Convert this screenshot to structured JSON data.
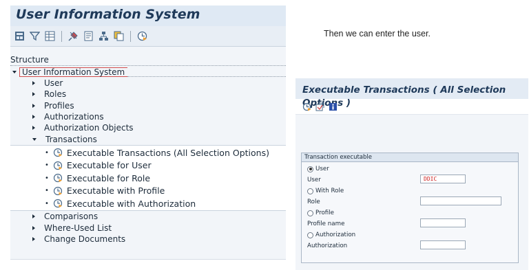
{
  "left_panel": {
    "title": "User Information System",
    "toolbar_icons": [
      "grid-save-icon",
      "filter-icon",
      "table-icon",
      "pin-icon",
      "document-icon",
      "hierarchy-icon",
      "copy-icon",
      "clock-execute-icon"
    ],
    "structure_label": "Structure",
    "root_label": "User Information System",
    "tree_items_top": [
      "User",
      "Roles",
      "Profiles",
      "Authorizations",
      "Authorization Objects"
    ],
    "transactions_label": "Transactions",
    "transaction_items": [
      "Executable Transactions (All Selection Options)",
      "Executable for User",
      "Executable for Role",
      "Executable with Profile",
      "Executable with Authorization"
    ],
    "tree_items_bottom": [
      "Comparisons",
      "Where-Used List",
      "Change Documents"
    ]
  },
  "caption": "Then we can enter the user.",
  "right_panel": {
    "title": "Executable Transactions ( All Selection Options )",
    "toolbar_icons": [
      "clock-execute-icon",
      "variant-icon",
      "info-icon"
    ],
    "group_title": "Transaction executable",
    "radio_user": "User",
    "label_user": "User",
    "user_value": "DDIC",
    "radio_role": "With Role",
    "label_role": "Role",
    "role_value": "",
    "radio_profile": "Profile",
    "label_profile": "Profile name",
    "profile_value": "",
    "radio_authorization": "Authorization",
    "label_authorization": "Authorization",
    "authorization_value": "",
    "selected_radio": "User"
  },
  "colors": {
    "title_text": "#1f3a5a",
    "panel_bg": "#f2f5f9",
    "selected_outline": "#d24b4b",
    "field_value": "#cc2222"
  }
}
